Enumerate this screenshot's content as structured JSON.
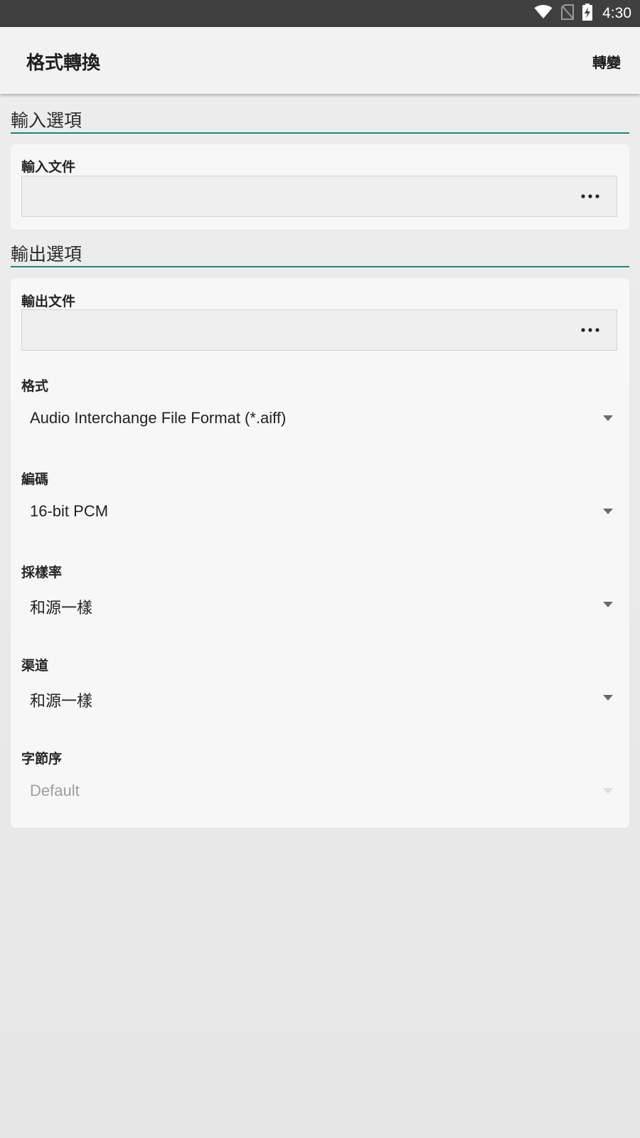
{
  "status_bar": {
    "time": "4:30",
    "icons": [
      "wifi-icon",
      "no-sim-icon",
      "battery-charging-icon"
    ]
  },
  "toolbar": {
    "title": "格式轉換",
    "action_label": "轉變"
  },
  "input_section": {
    "header": "輸入選項",
    "input_file_label": "輸入文件",
    "input_file_value": "",
    "browse_icon": "more-horizontal-icon"
  },
  "output_section": {
    "header": "輸出選項",
    "output_file_label": "輸出文件",
    "output_file_value": "",
    "browse_icon": "more-horizontal-icon",
    "format": {
      "label": "格式",
      "value": "Audio Interchange File Format (*.aiff)"
    },
    "encoding": {
      "label": "編碼",
      "value": "16-bit PCM"
    },
    "sample_rate": {
      "label": "採樣率",
      "value": "和源一樣"
    },
    "channels": {
      "label": "渠道",
      "value": "和源一樣"
    },
    "byte_order": {
      "label": "字節序",
      "value": "Default",
      "enabled": false
    }
  },
  "colors": {
    "accent": "#138a7e",
    "status_bar": "#3f3f3f",
    "toolbar": "#f2f2f2",
    "card": "#f7f7f7"
  }
}
